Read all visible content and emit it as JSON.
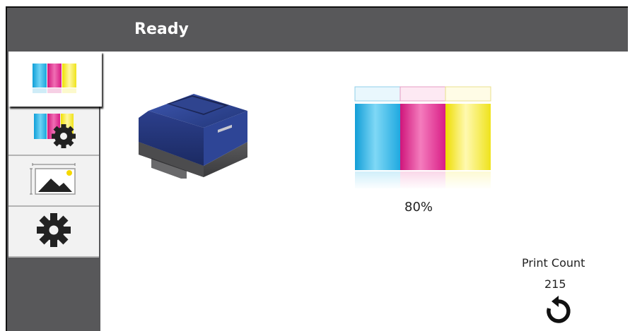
{
  "header": {
    "status": "Ready"
  },
  "sidebar": {
    "items": [
      {
        "name": "ink-levels",
        "icon": "cmyk-ink-icon",
        "active": true
      },
      {
        "name": "ink-settings",
        "icon": "ink-gear-icon",
        "active": false
      },
      {
        "name": "image-settings",
        "icon": "image-landscape-icon",
        "active": false
      },
      {
        "name": "settings",
        "icon": "gear-icon",
        "active": false
      }
    ]
  },
  "main": {
    "printer_image": "printer-icon",
    "ink_level_percent": "80%",
    "ink_level_fraction": 0.8,
    "ink_colors": [
      "#22b2ea",
      "#e6228c",
      "#f5ec1a"
    ],
    "print_count_label": "Print Count",
    "print_count_value": "215",
    "reset_icon": "reset-icon"
  },
  "colors": {
    "header_bg": "#58585a",
    "sidebar_bg": "#58585a",
    "cyan": "#22b2ea",
    "magenta": "#e6228c",
    "yellow": "#f5ec1a",
    "printer_blue": "#2a3f8f"
  }
}
